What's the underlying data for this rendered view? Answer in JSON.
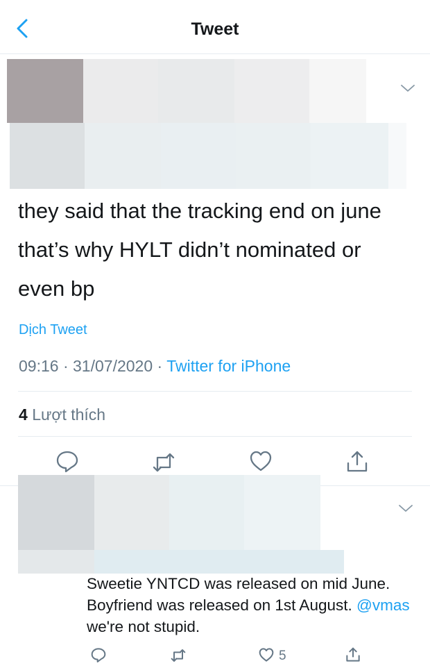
{
  "header": {
    "title": "Tweet"
  },
  "tweet": {
    "text": "they said that the tracking end on june that’s why HYLT didn’t nominated or even bp",
    "translate_label": "Dịch Tweet",
    "time": "09:16",
    "date": "31/07/2020",
    "separator": "·",
    "source": "Twitter for iPhone",
    "likes_count": "4",
    "likes_label": "Lượt thích"
  },
  "reply": {
    "text_part1": "Sweetie YNTCD was released on mid June. Boyfriend was released on 1st August. ",
    "mention": "@vmas",
    "text_part2": "  we're not stupid.",
    "like_count": "5"
  },
  "colors": {
    "accent": "#1da1f2",
    "secondary_text": "#657786",
    "border": "#e6ecf0"
  },
  "icons": [
    "chevron-left-icon",
    "chevron-down-icon",
    "reply-icon",
    "retweet-icon",
    "like-icon",
    "share-icon"
  ]
}
